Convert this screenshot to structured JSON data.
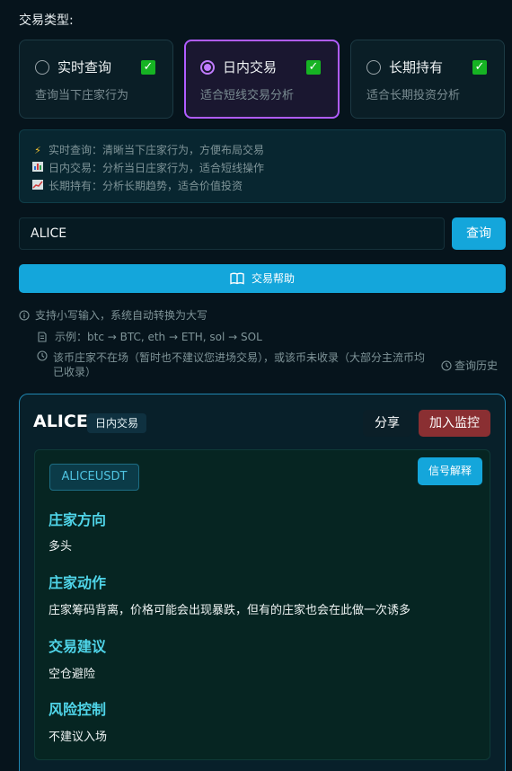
{
  "trade_type": {
    "title": "交易类型:",
    "options": [
      {
        "label": "实时查询",
        "desc": "查询当下庄家行为",
        "selected": false,
        "checked": true
      },
      {
        "label": "日内交易",
        "desc": "适合短线交易分析",
        "selected": true,
        "checked": true
      },
      {
        "label": "长期持有",
        "desc": "适合长期投资分析",
        "selected": false,
        "checked": true
      }
    ]
  },
  "info": {
    "lines": [
      {
        "icon": "lightning-icon",
        "text": "实时查询：清晰当下庄家行为，方便布局交易"
      },
      {
        "icon": "bar-chart-icon",
        "text": "日内交易：分析当日庄家行为，适合短线操作"
      },
      {
        "icon": "trend-chart-icon",
        "text": "长期持有：分析长期趋势，适合价值投资"
      }
    ]
  },
  "search": {
    "value": "ALICE",
    "query_label": "查询",
    "help_label": "交易帮助"
  },
  "hints": {
    "lowercase": "支持小写输入，系统自动转换为大写",
    "example": "示例：btc → BTC, eth → ETH, sol → SOL",
    "not_listed_line1": "该币庄家不在场（暂时也不建议您进场交易），或该币未收录（大部分主流币均",
    "not_listed_line2": "已收录）",
    "history_label": "查询历史"
  },
  "result": {
    "title": "ALICE",
    "badge": "日内交易",
    "share_label": "分享",
    "monitor_label": "加入监控",
    "symbol": "ALICEUSDT",
    "signal_label": "信号解释",
    "sections": [
      {
        "heading": "庄家方向",
        "body": "多头"
      },
      {
        "heading": "庄家动作",
        "body": "庄家筹码背离，价格可能会出现暴跌，但有的庄家也会在此做一次诱多"
      },
      {
        "heading": "交易建议",
        "body": "空仓避险"
      },
      {
        "heading": "风险控制",
        "body": "不建议入场"
      }
    ]
  },
  "colors": {
    "accent": "#14a6db",
    "selected_border": "#b05cff",
    "check": "#16b323",
    "monitor": "#8a2f32",
    "section_heading": "#4fd4e8"
  }
}
